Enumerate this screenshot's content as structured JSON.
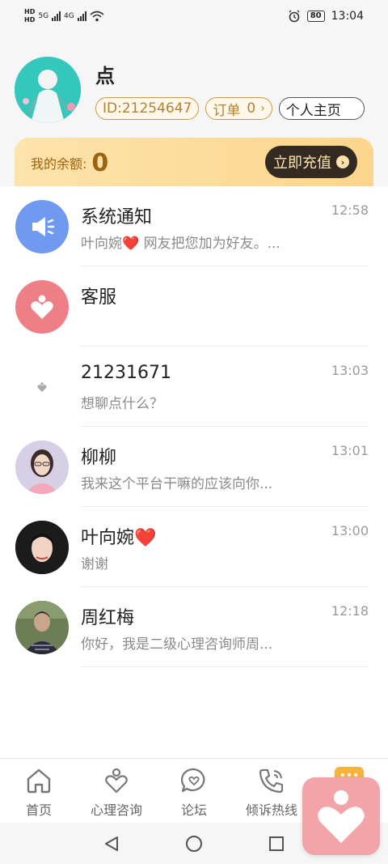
{
  "status_bar": {
    "hd1": "HD",
    "hd2": "HD",
    "net1": "5G",
    "net2": "4G",
    "battery": "80",
    "time": "13:04"
  },
  "profile": {
    "name": "点",
    "id_label": "ID:21254647",
    "order_label": "订单",
    "order_count": "0",
    "homepage_label": "个人主页"
  },
  "balance": {
    "label": "我的余额:",
    "value": "0",
    "recharge_label": "立即充值"
  },
  "messages": [
    {
      "name": "系统通知",
      "preview": "叶向婉❤️ 网友把您加为好友。...",
      "time": "12:58",
      "icon": "megaphone-icon"
    },
    {
      "name": "客服",
      "preview": "",
      "time": "",
      "icon": "heart-logo-icon"
    },
    {
      "name": "21231671",
      "preview": "想聊点什么？",
      "time": "13:03",
      "icon": "small-heart-icon"
    },
    {
      "name": "柳柳",
      "preview": "我来这个平台干嘛的应该向你...",
      "time": "13:01",
      "icon": "avatar-woman-glasses"
    },
    {
      "name": "叶向婉❤️",
      "preview": "谢谢",
      "time": "13:00",
      "icon": "avatar-woman"
    },
    {
      "name": "周红梅",
      "preview": "你好，我是二级心理咨询师周...",
      "time": "12:18",
      "icon": "avatar-woman-outdoor"
    }
  ],
  "tabs": [
    {
      "label": "首页",
      "icon": "home-icon"
    },
    {
      "label": "心理咨询",
      "icon": "person-heart-icon"
    },
    {
      "label": "论坛",
      "icon": "chat-heart-icon"
    },
    {
      "label": "倾诉热线",
      "icon": "phone-icon"
    },
    {
      "label": "",
      "icon": "more-icon"
    }
  ],
  "colors": {
    "accent_gold": "#b5822c",
    "balance_bg": "#fbd68b",
    "recharge_bg": "#332a22",
    "float_bg": "#f2a4a8",
    "system_blue": "#6f9af0",
    "service_pink": "#ef7f86"
  }
}
